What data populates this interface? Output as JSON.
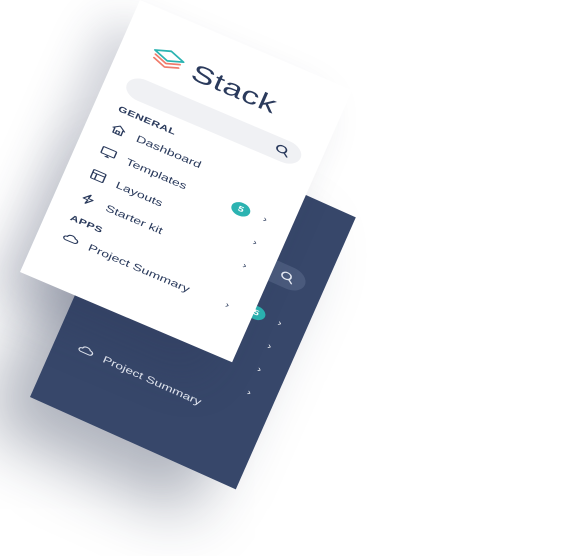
{
  "brand": {
    "name": "Stack"
  },
  "search": {
    "placeholder": ""
  },
  "sections": {
    "general": "GENERAL",
    "apps": "APPS"
  },
  "nav": {
    "dashboard": "Dashboard",
    "templates": "Templates",
    "layouts": "Layouts",
    "starter_kit": "Starter kit",
    "project_summary": "Project Summary"
  },
  "badges": {
    "templates_count": "5"
  },
  "chevron": "›",
  "colors": {
    "dark_panel": "#37476a",
    "light_panel": "#ffffff",
    "text": "#2a3a5c",
    "badge": "#2bb3b1",
    "logo_top": "#2bb3b1",
    "logo_bottom": "#f07b6b"
  },
  "icons": {
    "dashboard": "home-icon",
    "templates": "monitor-icon",
    "layouts": "layout-icon",
    "starter_kit": "bolt-icon",
    "project_summary": "cloud-icon",
    "search": "search-icon",
    "logo": "stack-logo-icon"
  }
}
